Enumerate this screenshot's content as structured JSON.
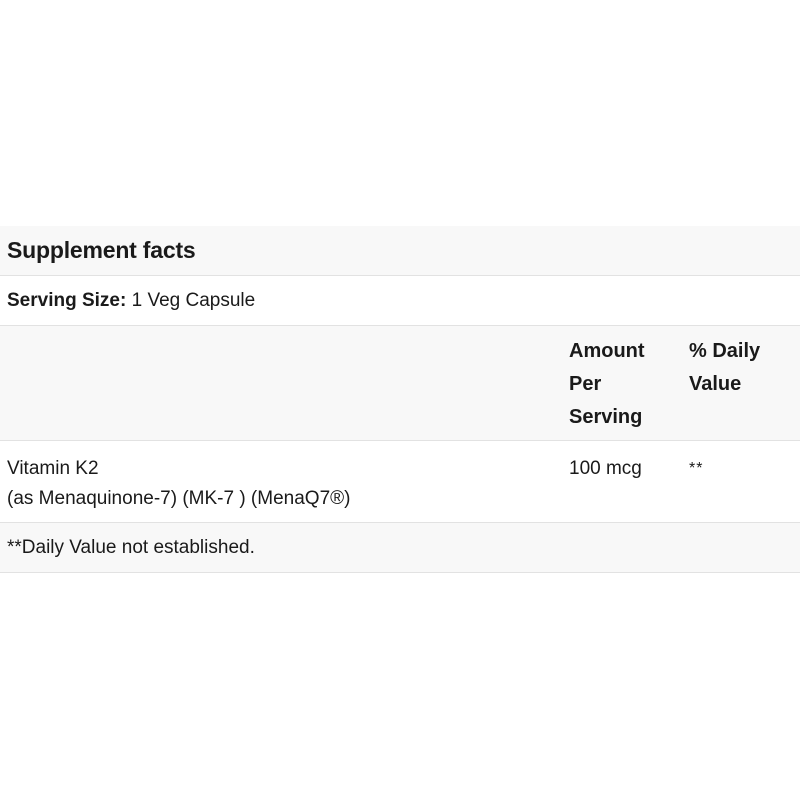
{
  "panel": {
    "title": "Supplement facts",
    "serving_label": "Serving Size:",
    "serving_value": "1 Veg Capsule",
    "headers": {
      "amount_line1": "Amount",
      "amount_line2": "Per",
      "amount_line3": "Serving",
      "dv_line1": "% Daily",
      "dv_line2": "Value"
    },
    "nutrients": [
      {
        "name": "Vitamin K2",
        "detail": "(as Menaquinone-7) (MK-7 ) (MenaQ7®)",
        "amount": "100 mcg",
        "daily_value": "**"
      }
    ],
    "footnote": "**Daily Value not established."
  }
}
